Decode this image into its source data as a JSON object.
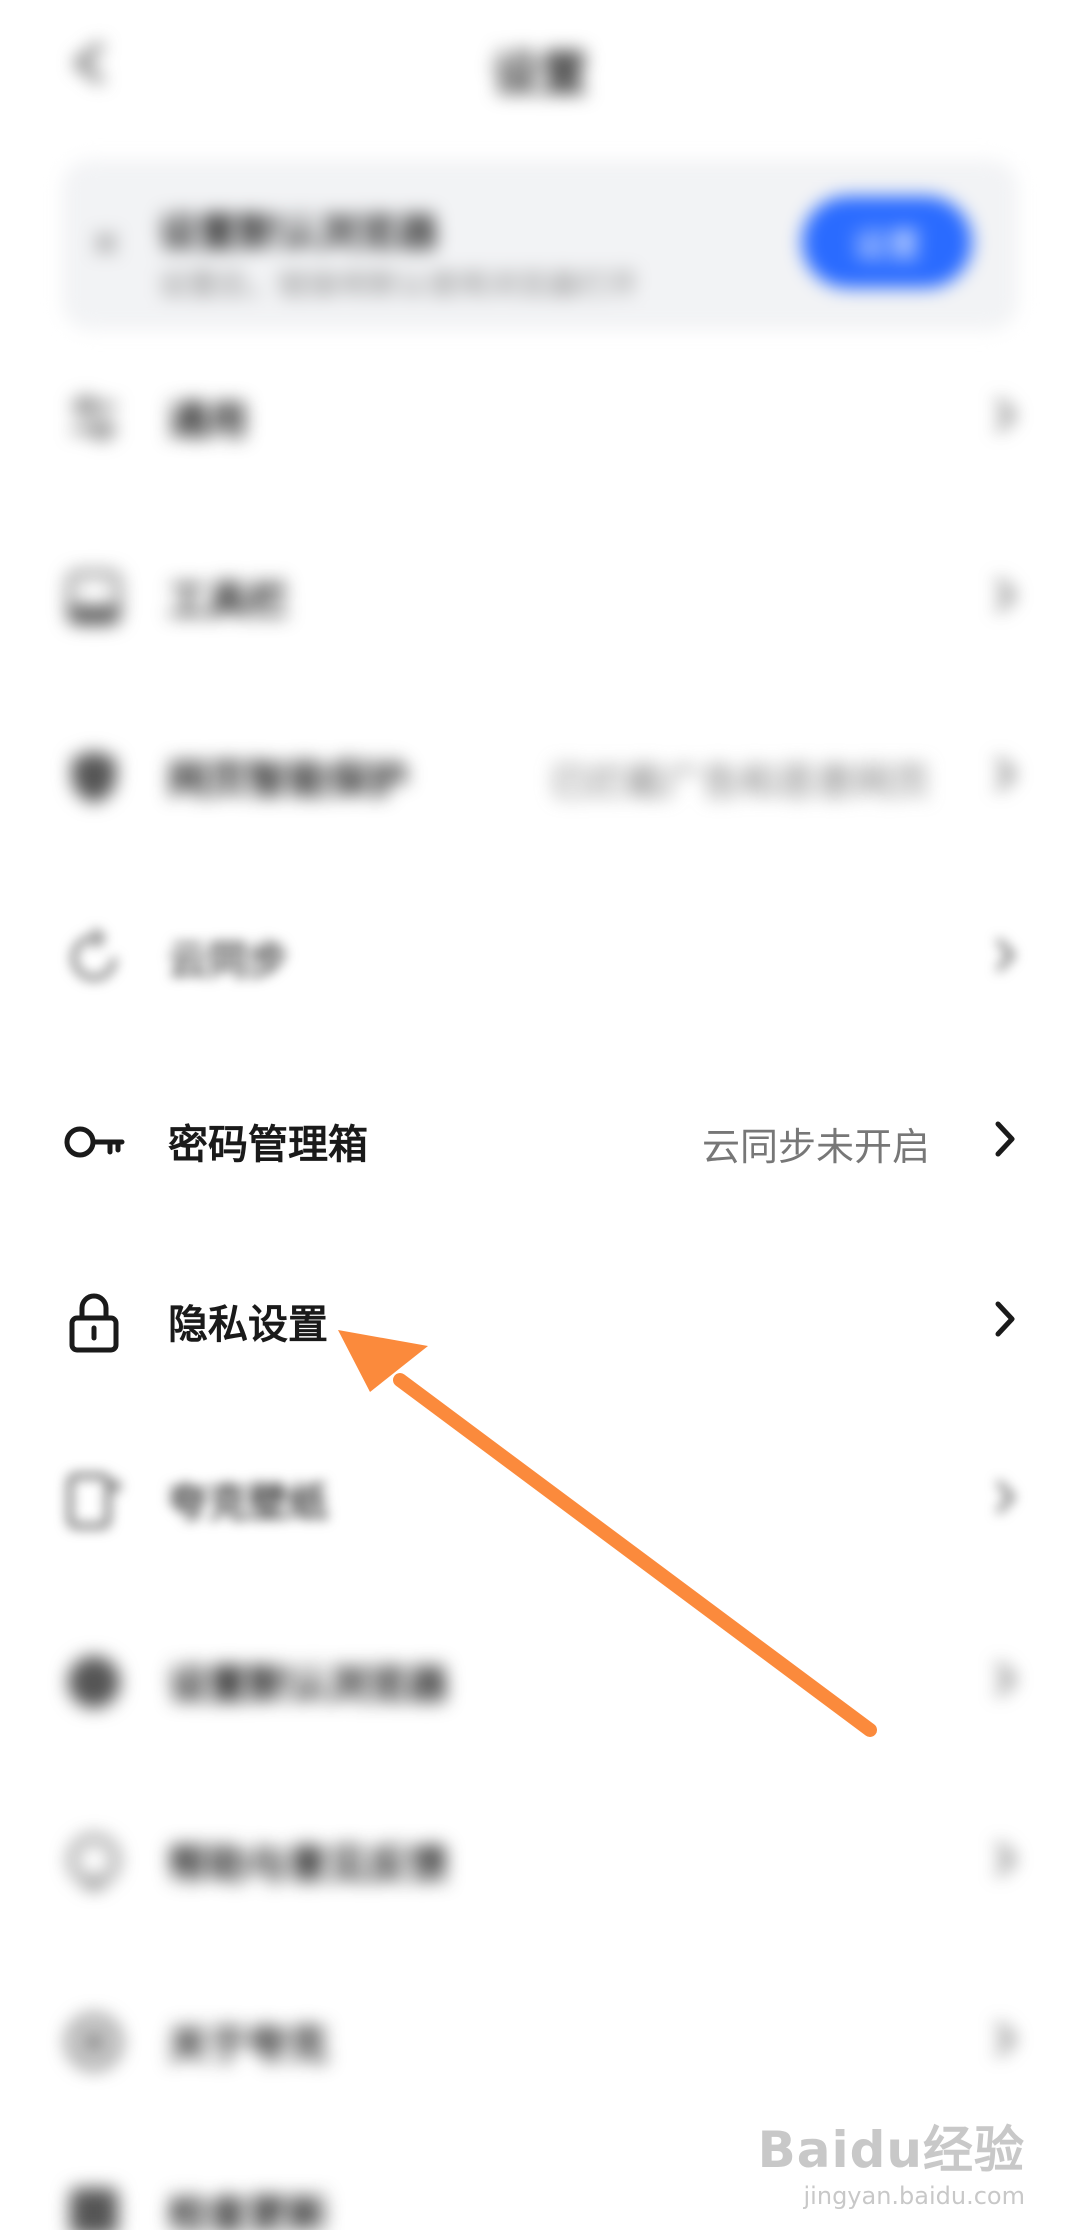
{
  "header": {
    "title": "设置",
    "back_icon": "back-arrow-icon"
  },
  "banner": {
    "title": "设置默认浏览器",
    "subtitle": "设置后，链接将默认使用浏览器打开",
    "button": "设置",
    "close_icon": "close-icon",
    "accent": "#2a6bff"
  },
  "rows": [
    {
      "label": "通用",
      "value": "",
      "icon": "settings-sliders-icon"
    },
    {
      "label": "工具栏",
      "value": "",
      "icon": "toolbar-icon"
    },
    {
      "label": "网页智能保护",
      "value": "已拦截广告和恶意网页",
      "icon": "shield-icon"
    },
    {
      "label": "云同步",
      "value": "",
      "icon": "cloud-sync-icon"
    },
    {
      "label": "密码管理箱",
      "value": "云同步未开启",
      "icon": "key-icon"
    },
    {
      "label": "隐私设置",
      "value": "",
      "icon": "lock-icon"
    },
    {
      "label": "夸克壁纸",
      "value": "",
      "icon": "wallpaper-icon"
    },
    {
      "label": "设置默认浏览器",
      "value": "",
      "icon": "browser-icon"
    },
    {
      "label": "帮助与意见反馈",
      "value": "",
      "icon": "help-icon"
    },
    {
      "label": "关于夸克",
      "value": "",
      "icon": "info-icon"
    },
    {
      "label": "检查更新",
      "value": "",
      "icon": "update-icon"
    }
  ],
  "annotation": {
    "arrow_color": "#fb8a3c",
    "arrow_icon": "pointer-arrow-icon"
  },
  "watermark": {
    "main": "Baidu经验",
    "sub": "jingyan.baidu.com"
  }
}
